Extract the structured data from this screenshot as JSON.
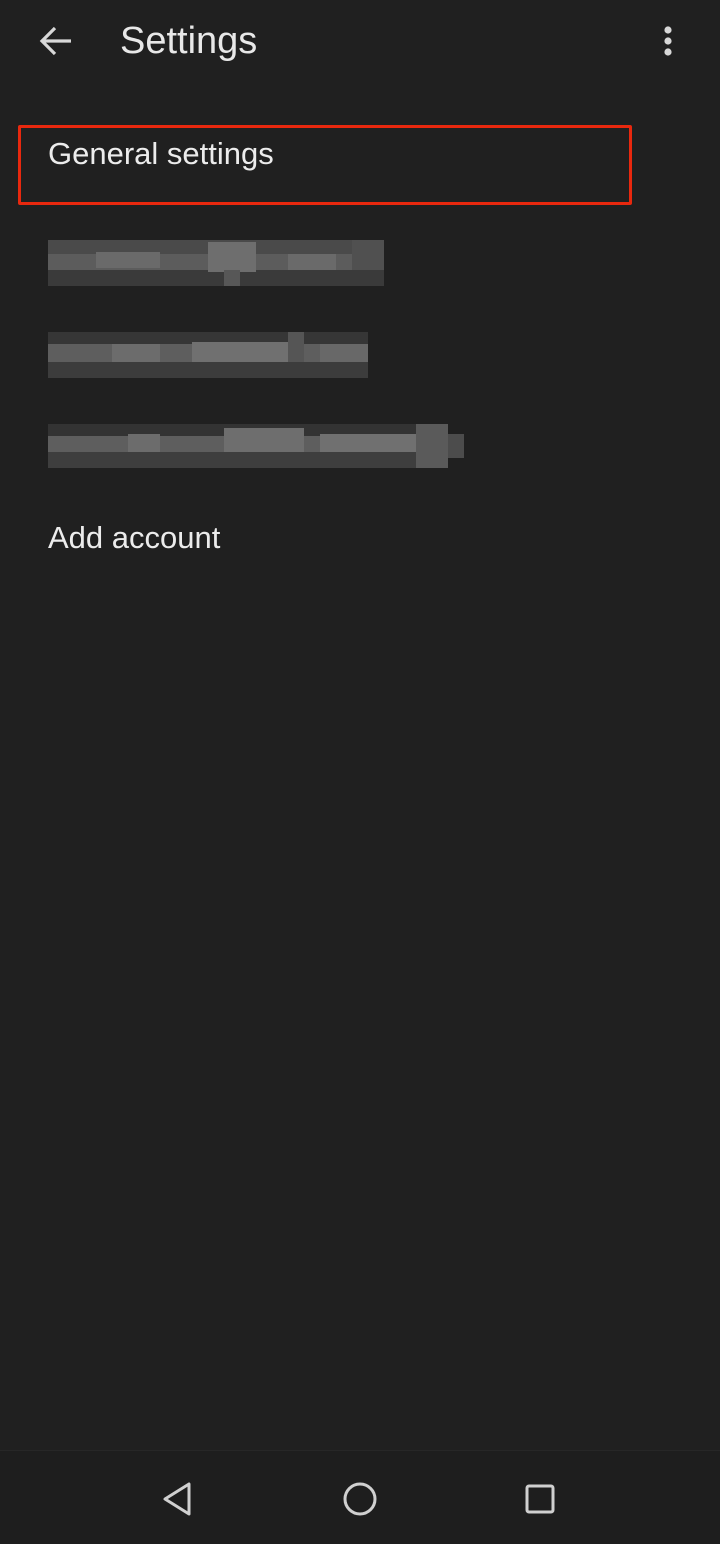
{
  "appbar": {
    "title": "Settings",
    "back_icon": "arrow-back-icon",
    "overflow_icon": "more-vert-icon"
  },
  "settings_list": {
    "general_settings_label": "General settings",
    "accounts": [
      {
        "state": "redacted"
      },
      {
        "state": "redacted"
      },
      {
        "state": "redacted"
      }
    ],
    "add_account_label": "Add account"
  },
  "navbar": {
    "back_icon": "triangle-back-icon",
    "home_icon": "circle-home-icon",
    "recents_icon": "square-recents-icon"
  },
  "colors": {
    "background": "#202020",
    "text": "#e8e8e8",
    "highlight": "#e8280e"
  }
}
